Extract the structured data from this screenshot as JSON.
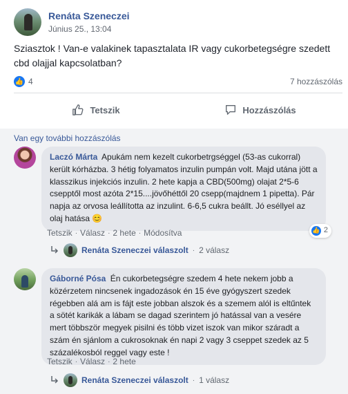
{
  "post": {
    "author": "Renáta Szeneczei",
    "date": "Június 25., 13:04",
    "text": "Sziasztok ! Van-e valakinek tapasztalata IR vagy cukorbetegségre szedett cbd olajjal kapcsolatban?",
    "like_count": "4",
    "comment_count": "7 hozzászólás"
  },
  "actions": {
    "like": "Tetszik",
    "comment": "Hozzászólás"
  },
  "more_comments": "Van egy további hozzászólás",
  "comments": [
    {
      "author": "Laczó Márta",
      "text": "Apukám nem kezelt cukorbetrgséggel (53-as cukorral) került kórházba. 3 hétig folyamatos inzulin pumpán volt. Majd utána jött a klasszikus injekciós inzulin. 2 hete kapja a CBD(500mg) olajat 2*5-6 csepptől most azóta 2*15....jövőhéttől 20 csepp(majdnem 1 pipetta). Pár napja az orvosa leállította az inzulint. 6-6,5 cukra beállt. Jó eséllyel az olaj hatása 😊",
      "like": "Tetszik",
      "reply": "Válasz",
      "time": "2 hete",
      "edited": "Módosítva",
      "reaction_count": "2",
      "reply_summary_author": "Renáta Szeneczei válaszolt",
      "reply_summary_count": "2 válasz"
    },
    {
      "author": "Gáborné Pósa",
      "text": "Én cukorbetegségre szedem 4 hete nekem jobb a közérzetem nincsenek ingadozások én 15 éve gyógyszert szedek régebben alá am is fájt este jobban alszok és a szemem alól is eltűntek a sötét karikák a lábam se dagad szerintem jó hatással van a vesére mert többször megyek pisilni és több vizet iszok van mikor száradt a szám én sjánlom a cukrosoknak én napi 2 vagy 3 cseppet szedek az 5 százalékosból reggel vagy este !",
      "like": "Tetszik",
      "reply": "Válasz",
      "time": "2 hete",
      "reply_summary_author": "Renáta Szeneczei válaszolt",
      "reply_summary_count": "1 válasz"
    }
  ],
  "colors": {
    "link": "#385898",
    "like_blue": "#1877f2",
    "bubble": "#e4e6eb",
    "comments_bg": "#f2f3f5"
  },
  "icons": {
    "like": "thumbs-up-icon",
    "comment": "speech-bubble-icon",
    "reply": "reply-arrow-icon"
  }
}
